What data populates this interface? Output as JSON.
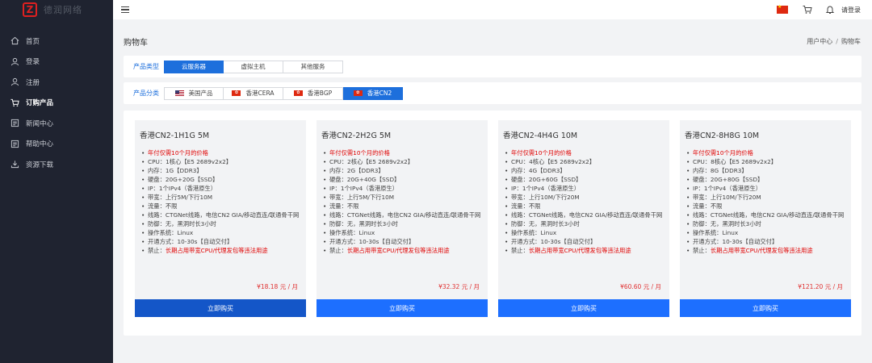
{
  "brand": {
    "logo_text": "德润网络"
  },
  "sidebar": {
    "items": [
      {
        "label": "首页",
        "icon": "home-icon",
        "active": false
      },
      {
        "label": "登录",
        "icon": "user-icon",
        "active": false
      },
      {
        "label": "注册",
        "icon": "user-add-icon",
        "active": false
      },
      {
        "label": "订购产品",
        "icon": "cart-icon",
        "active": true
      },
      {
        "label": "新闻中心",
        "icon": "news-icon",
        "active": false
      },
      {
        "label": "帮助中心",
        "icon": "help-icon",
        "active": false
      },
      {
        "label": "资源下载",
        "icon": "download-icon",
        "active": false
      }
    ]
  },
  "topbar": {
    "login_label": "请登录"
  },
  "page": {
    "title": "购物车"
  },
  "breadcrumb": {
    "parent": "用户中心",
    "current": "购物车"
  },
  "filters": {
    "type_label": "产品类型",
    "types": [
      "云服务器",
      "虚拟主机",
      "其他服务"
    ],
    "active_type": 0,
    "category_label": "产品分类",
    "categories": [
      {
        "label": "美国产品",
        "flag": "us"
      },
      {
        "label": "香港CERA",
        "flag": "hk"
      },
      {
        "label": "香港BGP",
        "flag": "hk"
      },
      {
        "label": "香港CN2",
        "flag": "hk"
      }
    ],
    "active_category": 3
  },
  "products": [
    {
      "title": "香港CN2-1H1G 5M",
      "features": {
        "promo": "年付仅需10个月的价格",
        "cpu": "CPU：1核心【E5 2689v2x2】",
        "ram": "内存：1G【DDR3】",
        "disk": "硬盘：20G+20G【SSD】",
        "ip": "IP：1个IPv4（香港原生）",
        "bw": "带宽：上行5M/下行10M",
        "traffic": "流量：不限",
        "line": "线路：CTGNet线路，电信CN2 GIA/移动直连/联通骨干网",
        "ddos": "防御：无，黑洞时长3小时",
        "os": "操作系统：Linux",
        "deploy": "开通方式：10-30s【自动交付】",
        "ban_prefix": "禁止：",
        "ban_text": "长期占用带宽CPU/代理发包等违法用途"
      },
      "price": "¥18.18 元 / 月",
      "buy_label": "立即购买"
    },
    {
      "title": "香港CN2-2H2G 5M",
      "features": {
        "promo": "年付仅需10个月的价格",
        "cpu": "CPU：2核心【E5 2689v2x2】",
        "ram": "内存：2G【DDR3】",
        "disk": "硬盘：20G+40G【SSD】",
        "ip": "IP：1个IPv4（香港原生）",
        "bw": "带宽：上行5M/下行10M",
        "traffic": "流量：不限",
        "line": "线路：CTGNet线路，电信CN2 GIA/移动直连/联通骨干网",
        "ddos": "防御：无，黑洞时长3小时",
        "os": "操作系统：Linux",
        "deploy": "开通方式：10-30s【自动交付】",
        "ban_prefix": "禁止：",
        "ban_text": "长期占用带宽CPU/代理发包等违法用途"
      },
      "price": "¥32.32 元 / 月",
      "buy_label": "立即购买"
    },
    {
      "title": "香港CN2-4H4G 10M",
      "features": {
        "promo": "年付仅需10个月的价格",
        "cpu": "CPU：4核心【E5 2689v2x2】",
        "ram": "内存：4G【DDR3】",
        "disk": "硬盘：20G+60G【SSD】",
        "ip": "IP：1个IPv4（香港原生）",
        "bw": "带宽：上行10M/下行20M",
        "traffic": "流量：不限",
        "line": "线路：CTGNet线路，电信CN2 GIA/移动直连/联通骨干网",
        "ddos": "防御：无，黑洞时长3小时",
        "os": "操作系统：Linux",
        "deploy": "开通方式：10-30s【自动交付】",
        "ban_prefix": "禁止：",
        "ban_text": "长期占用带宽CPU/代理发包等违法用途"
      },
      "price": "¥60.60 元 / 月",
      "buy_label": "立即购买"
    },
    {
      "title": "香港CN2-8H8G 10M",
      "features": {
        "promo": "年付仅需10个月的价格",
        "cpu": "CPU：8核心【E5 2689v2x2】",
        "ram": "内存：8G【DDR3】",
        "disk": "硬盘：20G+80G【SSD】",
        "ip": "IP：1个IPv4（香港原生）",
        "bw": "带宽：上行10M/下行20M",
        "traffic": "流量：不限",
        "line": "线路：CTGNet线路，电信CN2 GIA/移动直连/联通骨干网",
        "ddos": "防御：无，黑洞时长3小时",
        "os": "操作系统：Linux",
        "deploy": "开通方式：10-30s【自动交付】",
        "ban_prefix": "禁止：",
        "ban_text": "长期占用带宽CPU/代理发包等违法用途"
      },
      "price": "¥121.20 元 / 月",
      "buy_label": "立即购买"
    }
  ],
  "colors": {
    "accent": "#1d6fdc",
    "button": "#1d6fff",
    "danger": "#e00000",
    "sidebar": "#1f2330"
  }
}
